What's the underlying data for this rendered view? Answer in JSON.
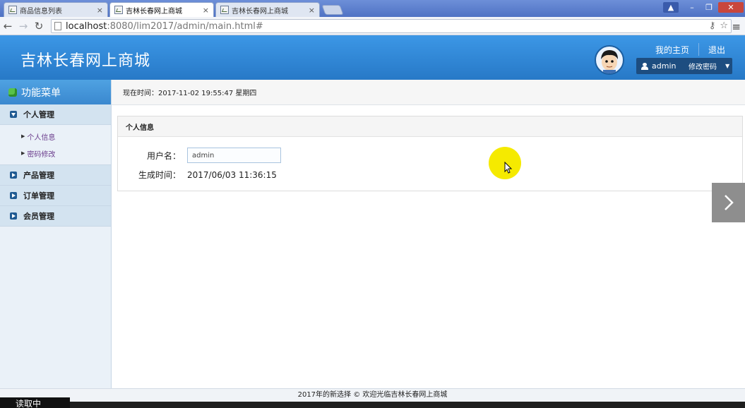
{
  "browser": {
    "tabs": [
      {
        "label": "商品信息列表",
        "active": false
      },
      {
        "label": "吉林长春网上商城",
        "active": true
      },
      {
        "label": "吉林长春网上商城",
        "active": false
      }
    ],
    "tab_close": "×",
    "url_host": "localhost",
    "url_rest": ":8080/lim2017/admin/main.html#",
    "window_buttons": {
      "minimize": "–",
      "restore": "❐",
      "close": "✕"
    }
  },
  "header": {
    "site_title": "吉林长春网上商城",
    "home_link": "我的主页",
    "logout_link": "退出",
    "username": "admin",
    "change_password": "修改密码"
  },
  "sidebar": {
    "title": "功能菜单",
    "groups": [
      {
        "label": "个人管理",
        "expanded": true,
        "items": [
          "个人信息",
          "密码修改"
        ]
      },
      {
        "label": "产品管理",
        "expanded": false
      },
      {
        "label": "订单管理",
        "expanded": false
      },
      {
        "label": "会员管理",
        "expanded": false
      }
    ]
  },
  "main": {
    "current_time": "现在时间：2017-11-02 19:55:47 星期四",
    "panel_title": "个人信息",
    "fields": {
      "username_label": "用户名：",
      "username_value": "admin",
      "created_label": "生成时间：",
      "created_value": "2017/06/03 11:36:15"
    }
  },
  "footer": {
    "text": "2017年的新选择 © 欢迎光临吉林长春网上商城"
  },
  "overlay": {
    "loading_text": "读取中"
  },
  "colors": {
    "header_blue": "#2f86d6",
    "sidebar_bg": "#eaf1f8",
    "highlight": "#f5ea00"
  }
}
